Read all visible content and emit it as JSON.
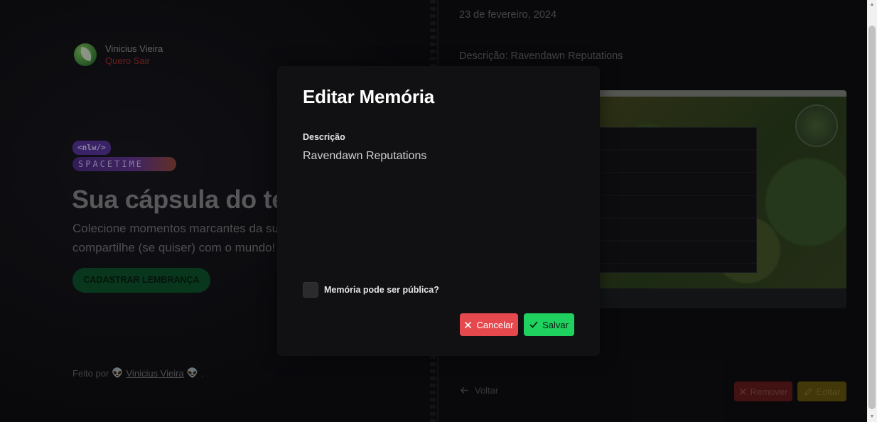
{
  "profile": {
    "name": "Vinicius Vieira",
    "logout_label": "Quero Sair"
  },
  "brand": {
    "nlw_tag": "<nlw/>",
    "spacetime_tag": "SPACETIME"
  },
  "hero": {
    "title": "Sua cápsula do te",
    "text": "Colecione momentos marcantes da sua compartilhe (se quiser) com o mundo!",
    "cta_label": "CADASTRAR LEMBRANÇA"
  },
  "footer": {
    "prefix": "Feito por",
    "author": "Vinicius Vieira",
    "suffix": "."
  },
  "memory": {
    "date": "23 de fevereiro, 2024",
    "description": "Descrição: Ravendawn Reputations",
    "back_label": "Voltar",
    "remove_label": "Remover",
    "edit_label": "Editar"
  },
  "modal": {
    "title": "Editar Memória",
    "description_label": "Descrição",
    "description_value": "Ravendawn Reputations",
    "public_label": "Memória pode ser pública?",
    "public_checked": false,
    "cancel_label": "Cancelar",
    "save_label": "Salvar"
  },
  "colors": {
    "cancel": "#e6494d",
    "save": "#1fd15f",
    "remove": "#6b1e1f",
    "edit": "#6a5a0e",
    "logout": "#a8322f"
  },
  "icons": {
    "cancel": "close-icon",
    "save": "check-icon",
    "back": "arrow-left-icon",
    "remove": "close-icon",
    "edit": "pencil-icon",
    "footer": "alien-icon"
  }
}
